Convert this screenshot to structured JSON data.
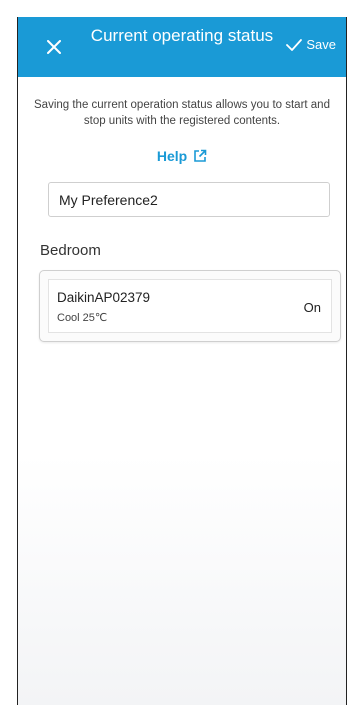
{
  "header": {
    "title": "Current operating status",
    "save_label": "Save"
  },
  "description": "Saving the current operation status allows you to start and stop units with the registered contents.",
  "help": {
    "label": "Help"
  },
  "name_input": {
    "value": "My Preference2"
  },
  "rooms": [
    {
      "label": "Bedroom",
      "units": [
        {
          "name": "DaikinAP02379",
          "mode": "Cool 25℃",
          "status": "On"
        }
      ]
    }
  ],
  "icons": {
    "close": "close-icon",
    "save": "check-icon",
    "help_link": "external-link-icon"
  },
  "colors": {
    "header_bg": "#1a9ad6",
    "accent": "#1a9ad6"
  }
}
